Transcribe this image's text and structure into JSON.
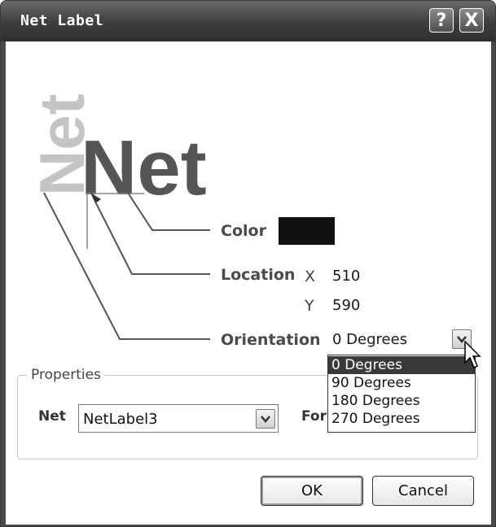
{
  "window": {
    "title": "Net Label"
  },
  "titlebar": {
    "help_label": "?",
    "close_label": "X"
  },
  "graphic": {
    "big_text": "Net",
    "rotated_text": "Net"
  },
  "props": {
    "color_label": "Color",
    "color_value": "#111111",
    "location_label": "Location",
    "x_label": "X",
    "x_value": "510",
    "y_label": "Y",
    "y_value": "590",
    "orientation_label": "Orientation",
    "orientation_value": "0 Degrees"
  },
  "orientation_options": [
    "0 Degrees",
    "90 Degrees",
    "180 Degrees",
    "270 Degrees"
  ],
  "properties_group": {
    "label": "Properties",
    "net_label": "Net",
    "net_value": "NetLabel3",
    "font_label": "For"
  },
  "buttons": {
    "ok": "OK",
    "cancel": "Cancel"
  }
}
